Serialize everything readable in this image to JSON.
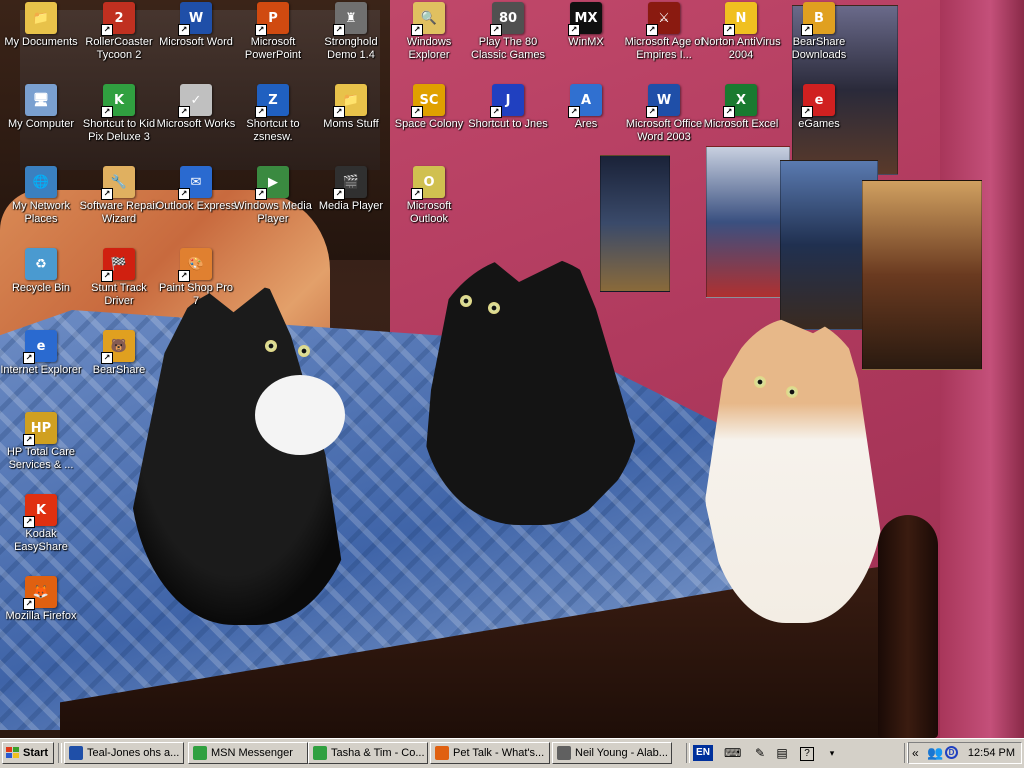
{
  "desktop": {
    "icons": [
      {
        "label": "My Documents",
        "icon": "folder-documents-icon",
        "color": "#e8c24a",
        "glyph": "📁"
      },
      {
        "label": "RollerCoaster Tycoon 2",
        "icon": "rollercoaster-tycoon-icon",
        "color": "#c03020",
        "glyph": "2"
      },
      {
        "label": "Microsoft Word",
        "icon": "word-icon",
        "color": "#1f4fa8",
        "glyph": "W"
      },
      {
        "label": "Microsoft PowerPoint",
        "icon": "powerpoint-icon",
        "color": "#d04a10",
        "glyph": "P"
      },
      {
        "label": "Stronghold Demo 1.4",
        "icon": "stronghold-icon",
        "color": "#707070",
        "glyph": "♜"
      },
      {
        "label": "Windows Explorer",
        "icon": "windows-explorer-icon",
        "color": "#e0c060",
        "glyph": "🔍"
      },
      {
        "label": "Play The 80 Classic Games",
        "icon": "classic-games-icon",
        "color": "#505050",
        "glyph": "80"
      },
      {
        "label": "WinMX",
        "icon": "winmx-icon",
        "color": "#101010",
        "glyph": "MX"
      },
      {
        "label": "Microsoft Age of Empires I...",
        "icon": "age-of-empires-icon",
        "color": "#8a1a10",
        "glyph": "⚔"
      },
      {
        "label": "Norton AntiVirus 2004",
        "icon": "norton-icon",
        "color": "#f0c020",
        "glyph": "N"
      },
      {
        "label": "BearShare Downloads",
        "icon": "bearshare-downloads-icon",
        "color": "#e0a020",
        "glyph": "B"
      },
      {
        "label": "My Computer",
        "icon": "my-computer-icon",
        "color": "#7aa0d0",
        "glyph": "🖥"
      },
      {
        "label": "Shortcut to Kid Pix Deluxe 3",
        "icon": "kid-pix-icon",
        "color": "#30a040",
        "glyph": "K"
      },
      {
        "label": "Microsoft Works",
        "icon": "works-icon",
        "color": "#c0c0c0",
        "glyph": "✓"
      },
      {
        "label": "Shortcut to zsnesw.",
        "icon": "zsnes-icon",
        "color": "#2060c0",
        "glyph": "Z"
      },
      {
        "label": "Moms Stuff",
        "icon": "folder-icon",
        "color": "#e8c24a",
        "glyph": "📁"
      },
      {
        "label": "Space Colony",
        "icon": "space-colony-icon",
        "color": "#e0a000",
        "glyph": "SC"
      },
      {
        "label": "Shortcut to Jnes",
        "icon": "jnes-icon",
        "color": "#2040c0",
        "glyph": "J"
      },
      {
        "label": "Ares",
        "icon": "ares-icon",
        "color": "#3070d0",
        "glyph": "A"
      },
      {
        "label": "Microsoft Office Word 2003",
        "icon": "word-2003-icon",
        "color": "#1f4fa8",
        "glyph": "W"
      },
      {
        "label": "Microsoft Excel",
        "icon": "excel-icon",
        "color": "#1a7a30",
        "glyph": "X"
      },
      {
        "label": "eGames",
        "icon": "egames-icon",
        "color": "#d02020",
        "glyph": "e"
      },
      {
        "label": "My Network Places",
        "icon": "network-places-icon",
        "color": "#3a80c0",
        "glyph": "🌐"
      },
      {
        "label": "Software Repair Wizard",
        "icon": "repair-wizard-icon",
        "color": "#e0b060",
        "glyph": "🔧"
      },
      {
        "label": "Outlook Express",
        "icon": "outlook-express-icon",
        "color": "#2a6ad0",
        "glyph": "✉"
      },
      {
        "label": "Windows Media Player",
        "icon": "media-player-icon",
        "color": "#3a8a40",
        "glyph": "▶"
      },
      {
        "label": "Media Player",
        "icon": "media-player-classic-icon",
        "color": "#303030",
        "glyph": "🎬"
      },
      {
        "label": "Microsoft Outlook",
        "icon": "outlook-icon",
        "color": "#d0c050",
        "glyph": "O"
      },
      {
        "label": "Recycle Bin",
        "icon": "recycle-bin-icon",
        "color": "#4a9ad0",
        "glyph": "♻"
      },
      {
        "label": "Stunt Track Driver",
        "icon": "stunt-track-icon",
        "color": "#d02010",
        "glyph": "🏁"
      },
      {
        "label": "Paint Shop Pro 7",
        "icon": "paint-shop-pro-icon",
        "color": "#e08030",
        "glyph": "🎨"
      },
      {
        "label": "Internet Explorer",
        "icon": "internet-explorer-icon",
        "color": "#2a6ad0",
        "glyph": "e"
      },
      {
        "label": "BearShare",
        "icon": "bearshare-icon",
        "color": "#e0a020",
        "glyph": "🐻"
      },
      {
        "label": "HP Total Care Services & ...",
        "icon": "hp-total-care-icon",
        "color": "#d0a020",
        "glyph": "HP"
      },
      {
        "label": "Kodak EasyShare",
        "icon": "kodak-icon",
        "color": "#e03010",
        "glyph": "K"
      },
      {
        "label": "Mozilla Firefox",
        "icon": "firefox-icon",
        "color": "#e06010",
        "glyph": "🦊"
      }
    ]
  },
  "taskbar": {
    "start_label": "Start",
    "tasks": [
      {
        "label": "Teal-Jones ohs a...",
        "icon": "word-doc-icon",
        "color": "#1f4fa8"
      },
      {
        "label": "MSN Messenger",
        "icon": "msn-messenger-icon",
        "color": "#30a040"
      },
      {
        "label": "Tasha & Tim - Co...",
        "icon": "conversation-icon",
        "color": "#30a040"
      },
      {
        "label": "Pet Talk - What's...",
        "icon": "firefox-icon",
        "color": "#e06010"
      },
      {
        "label": "Neil Young - Alab...",
        "icon": "media-icon",
        "color": "#606060"
      }
    ],
    "language": "EN",
    "tray_expand": "«",
    "clock": "12:54 PM"
  }
}
